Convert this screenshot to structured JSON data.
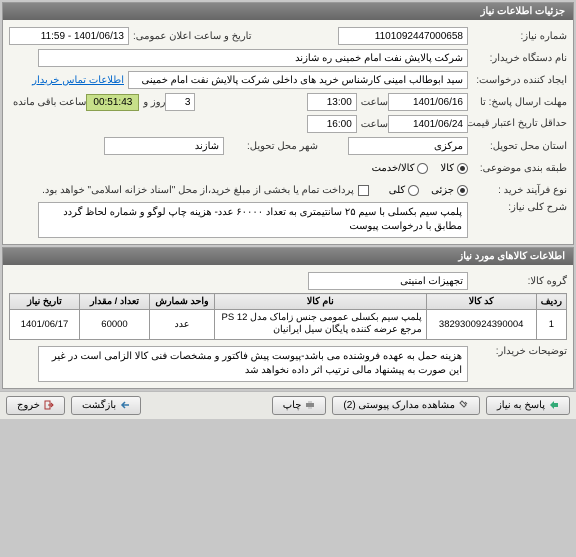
{
  "panel1": {
    "title": "جزئیات اطلاعات نیاز",
    "need_no_label": "شماره نیاز:",
    "need_no": "1101092447000658",
    "announce_label": "تاریخ و ساعت اعلان عمومی:",
    "announce_val": "1401/06/13 - 11:59",
    "buyer_label": "نام دستگاه خریدار:",
    "buyer_val": "شرکت پالایش نفت امام خمینی  ره  شازند",
    "creator_label": "ایجاد کننده درخواست:",
    "creator_val": "سید ابوطالب  امینی کارشناس خرید های داخلی  شرکت پالایش نفت امام خمینی",
    "creator_link": "اطلاعات تماس خریدار",
    "deadline_label": "مهلت ارسال پاسخ:",
    "ta": "تا",
    "until_label": "تاریخ:",
    "until_date": "1401/06/16",
    "time_label": "ساعت",
    "until_time": "13:00",
    "days": "3",
    "days_label": "روز و",
    "countdown": "00:51:43",
    "remain_label": "ساعت باقی مانده",
    "valid_label": "حداقل تاریخ اعتبار قیمت/تا تاریخ:",
    "valid_date": "1401/06/24",
    "valid_time": "16:00",
    "province_label": "استان محل تحویل:",
    "province_val": "مرکزی",
    "city_label": "شهر محل تحویل:",
    "city_val": "شازند",
    "single_label": "طبقه بندی موضوعی:",
    "opt_kala": "کالا",
    "opt_service": "کالا/خدمت",
    "proc_label": "نوع فرآیند خرید :",
    "opt_partial": "جزئی",
    "opt_full": "کلی",
    "pay_note": "پرداخت تمام یا بخشی از مبلغ خرید،از محل \"اسناد خزانه اسلامی\" خواهد بود.",
    "desc_label": "شرح کلی نیاز:",
    "desc_val": "پلمپ سیم بکسلی با سیم ۲۵ سانتیمتری به تعداد ۶۰۰۰۰ عدد- هزینه چاپ لوگو و شماره لحاظ گردد مطابق با درخواست پیوست"
  },
  "panel2": {
    "title": "اطلاعات کالاهای مورد نیاز",
    "group_label": "گروه کالا:",
    "group_val": "تجهیزات امنیتی",
    "columns": [
      "ردیف",
      "کد کالا",
      "نام کالا",
      "واحد شمارش",
      "تعداد / مقدار",
      "تاریخ نیاز"
    ],
    "row": {
      "idx": "1",
      "code": "3829300924390004",
      "name": "پلمپ سیم بکسلی عمومی جنس زاماک مدل PS 12 مرجع عرضه کننده پایگان سیل ایرانیان",
      "unit": "عدد",
      "qty": "60000",
      "date": "1401/06/17"
    },
    "notes_label": "توضیحات خریدار:",
    "notes_val": "هزینه حمل به عهده فروشنده می باشد-پیوست پیش فاکتور و مشخصات فنی کالا الزامی است در غیر این صورت به پیشنهاد مالی ترتیب اثر داده نخواهد شد"
  },
  "buttons": {
    "reply": "پاسخ به نیاز",
    "attach": "مشاهده مدارک پیوستی (2)",
    "print": "چاپ",
    "back": "بازگشت",
    "exit": "خروج"
  }
}
